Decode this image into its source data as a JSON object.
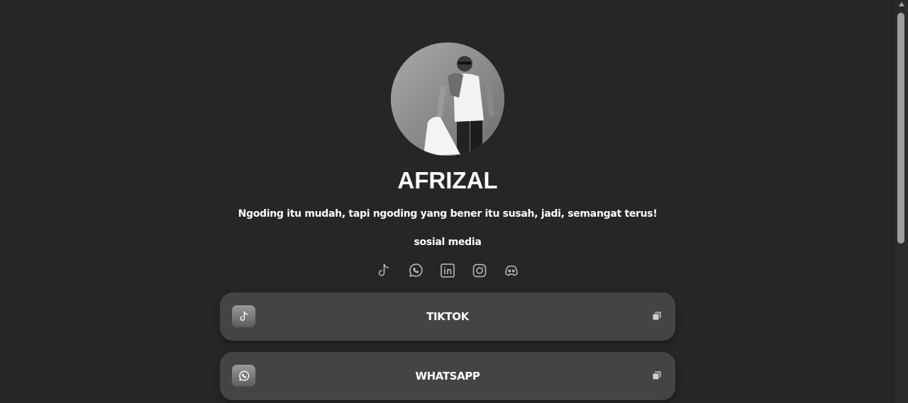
{
  "profile": {
    "name": "AFRIZAL",
    "bio": "Ngoding itu mudah, tapi ngoding yang bener itu susah, jadi, semangat terus!"
  },
  "social": {
    "title": "sosial media",
    "icons": [
      "tiktok-icon",
      "whatsapp-icon",
      "linkedin-icon",
      "instagram-icon",
      "discord-icon"
    ]
  },
  "links": [
    {
      "label": "TIKTOK",
      "icon": "tiktok-icon"
    },
    {
      "label": "WHATSAPP",
      "icon": "whatsapp-icon"
    }
  ],
  "colors": {
    "background": "#262626",
    "card": "#444444",
    "text": "#ffffff",
    "icon": "#bdbdbd"
  }
}
